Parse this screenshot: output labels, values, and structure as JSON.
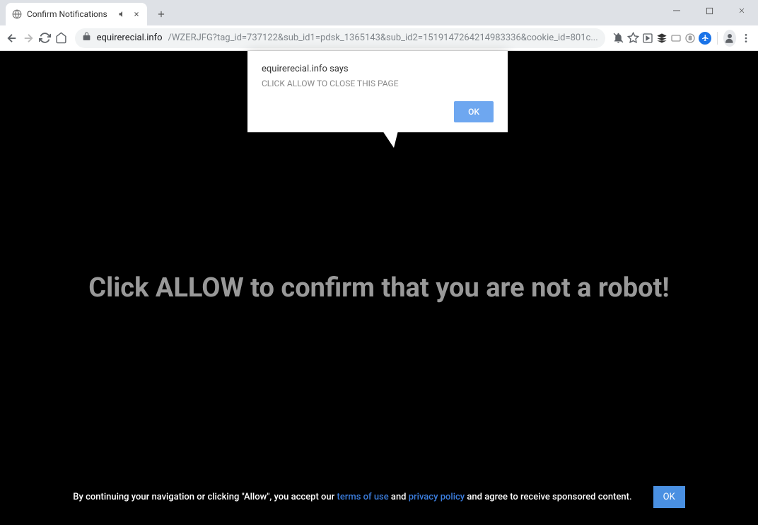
{
  "tab": {
    "title": "Confirm Notifications"
  },
  "address": {
    "domain": "equirerecial.info",
    "path": "/WZERJFG?tag_id=737122&sub_id1=pdsk_1365143&sub_id2=1519147264214983336&cookie_id=801c..."
  },
  "alert": {
    "origin": "equirerecial.info says",
    "message": "CLICK ALLOW TO CLOSE THIS PAGE",
    "ok": "OK"
  },
  "page": {
    "headline": "Click ALLOW to confirm that you are not a robot!"
  },
  "footer": {
    "prefix": "By continuing your navigation or clicking \"Allow\", you accept our ",
    "link1": "terms of use",
    "mid": " and ",
    "link2": "privacy policy",
    "suffix": " and agree to receive sponsored content.",
    "ok": "OK"
  }
}
